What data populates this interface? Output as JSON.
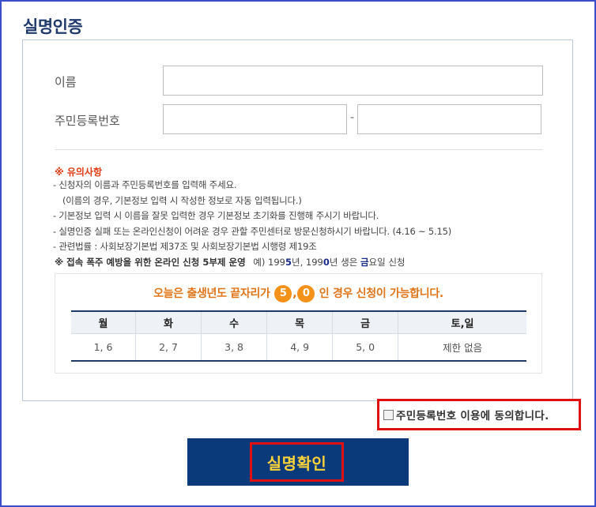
{
  "page": {
    "title": "실명인증"
  },
  "form": {
    "name_label": "이름",
    "rrn_label": "주민등록번호",
    "rrn_separator": "-"
  },
  "notice": {
    "title": "※ 유의사항",
    "items": [
      "- 신청자의 이름과 주민등록번호를 입력해 주세요.",
      "(이름의 경우, 기본정보 입력 시 작성한 정보로 자동 입력됩니다.)",
      "- 기본정보 입력 시 이름을 잘못 입력한 경우 기본정보 초기화를 진행해 주시기 바랍니다.",
      "- 실명인증 실패 또는 온라인신청이 어려운 경우 관할 주민센터로 방문신청하시기 바랍니다. (4.16 ~ 5.15)",
      "- 관련법률 : 사회보장기본법 제37조 및 사회보장기본법 시행령 제19조"
    ]
  },
  "rule": {
    "headline": "※ 접속 폭주 예방을 위한 온라인 신청 5부제 운영",
    "example": [
      "예) 199",
      "5",
      "년, 199",
      "0",
      "년 생은 ",
      "금",
      "요일 신청"
    ]
  },
  "schedule": {
    "today_prefix": "오늘은 출생년도 끝자리가",
    "digits": [
      "5",
      "0"
    ],
    "digit_separator": ",",
    "today_suffix": "인 경우 신청이 가능합니다.",
    "days": [
      "월",
      "화",
      "수",
      "목",
      "금",
      "토,일"
    ],
    "values": [
      "1, 6",
      "2, 7",
      "3, 8",
      "4, 9",
      "5, 0",
      "제한 없음"
    ]
  },
  "agreement": {
    "label": "주민등록번호 이용에 동의합니다."
  },
  "confirm": {
    "label": "실명확인"
  },
  "colors": {
    "title": "#1f3a6b",
    "notice_title": "#e03b12",
    "highlight": "#e07418",
    "button_bg": "#0b3a7a",
    "button_text": "#ffd33a",
    "annotation_border": "#e01010",
    "frame_border": "#3a4ec9"
  }
}
